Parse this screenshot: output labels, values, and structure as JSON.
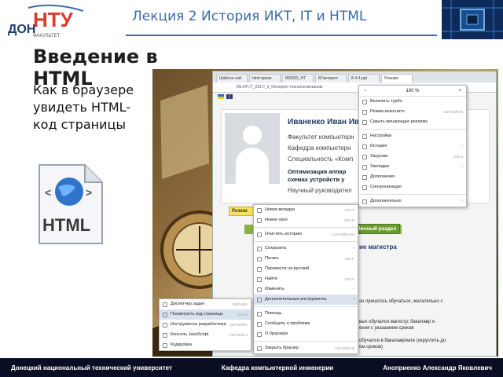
{
  "header": {
    "title": "Лекция 2 История ИКТ, IT и HTML",
    "logo_text_top": "ДОН",
    "logo_text_main": "НТУ",
    "logo_sub": "ФАКУЛЬТЕТ",
    "accent": "#3d6aa5"
  },
  "left": {
    "heading": "Введение в HTML",
    "body": "Как в браузере увидеть HTML-код страницы",
    "icon_label": "HTML"
  },
  "browser": {
    "tabs": [
      "Шаблон сай",
      "html-прези",
      "802050_HT",
      "БГинтерне",
      "8-4-4.ppt",
      "Резюме"
    ],
    "active_tab": 5,
    "address": "file:///F:/7_2017/_3_Интернет-технологии/заним",
    "page": {
      "name": "Иваненко Иван Ив",
      "lines": [
        "Факультет компьютерн",
        "Кафедра компьютерн",
        "Специальность «Комп"
      ],
      "bold_line_1": "Оптимизация аппар",
      "bold_line_2": "схемах устройств у",
      "advisor": "Научный руководител",
      "yellow_button": "Резюм",
      "green_button": "Личный раздел",
      "section_title": "ие магистра",
      "lower_lines": [
        "ах пришлось обучаться, желательно с",
        "вых обучался магистр; бакалавр и",
        "ения с указанием сроков",
        "обучался в бакалавриате (округлить до",
        "ом сроков)"
      ]
    }
  },
  "yandex_menu": {
    "zoom_minus": "−",
    "zoom_value": "100 %",
    "zoom_plus": "+",
    "items": [
      {
        "label": "Включить турбо",
        "shortcut": "",
        "arrow": ""
      },
      {
        "label": "Режим инкогнито",
        "shortcut": "Ctrl+Shift+N",
        "arrow": ""
      },
      {
        "label": "Скрыть мешающую рекламу",
        "shortcut": "",
        "arrow": ""
      },
      {
        "label": "Настройки",
        "shortcut": "",
        "arrow": ""
      },
      {
        "label": "История",
        "shortcut": "",
        "arrow": "›"
      },
      {
        "label": "Загрузки",
        "shortcut": "Ctrl+J",
        "arrow": ""
      },
      {
        "label": "Закладки",
        "shortcut": "",
        "arrow": "›"
      },
      {
        "label": "Дополнения",
        "shortcut": "",
        "arrow": ""
      },
      {
        "label": "Синхронизация",
        "shortcut": "",
        "arrow": ""
      },
      {
        "label": "Дополнительно",
        "shortcut": "",
        "arrow": "›"
      }
    ]
  },
  "context_menu": {
    "items": [
      {
        "label": "Новая вкладка",
        "shortcut": "Ctrl+T",
        "arrow": ""
      },
      {
        "label": "Новое окно",
        "shortcut": "Ctrl+N",
        "arrow": ""
      },
      {
        "label": "Очистить историю",
        "shortcut": "Ctrl+Shift+Del",
        "arrow": ""
      },
      {
        "label": "Сохранить",
        "shortcut": "",
        "arrow": "›"
      },
      {
        "label": "Печать",
        "shortcut": "Ctrl+P",
        "arrow": ""
      },
      {
        "label": "Перевести на русский",
        "shortcut": "",
        "arrow": ""
      },
      {
        "label": "Найти",
        "shortcut": "Ctrl+F",
        "arrow": ""
      },
      {
        "label": "Изменить",
        "shortcut": "",
        "arrow": "›"
      },
      {
        "label": "Дополнительные инструменты",
        "shortcut": "",
        "arrow": "›"
      },
      {
        "label": "Помощь",
        "shortcut": "",
        "arrow": ""
      },
      {
        "label": "Сообщить о проблеме",
        "shortcut": "",
        "arrow": ""
      },
      {
        "label": "О браузере",
        "shortcut": "",
        "arrow": ""
      },
      {
        "label": "Закрыть браузер",
        "shortcut": "Ctrl+Shift+Q",
        "arrow": ""
      }
    ]
  },
  "sub_menu": {
    "items": [
      {
        "label": "Диспетчер задач",
        "shortcut": "Shift+Esc"
      },
      {
        "label": "Посмотреть код страницы",
        "shortcut": "Ctrl+U"
      },
      {
        "label": "Инструменты разработчика",
        "shortcut": "Ctrl+Shift+I"
      },
      {
        "label": "Консоль JavaScript",
        "shortcut": "Ctrl+Shift+J"
      },
      {
        "label": "Кодировка",
        "shortcut": ""
      }
    ]
  },
  "footer": {
    "university": "Донецкий национальный технический университет",
    "department": "Кафедра компьютерной инженерии",
    "author": "Аноприенко Александр Яковлевич",
    "bg": "#0a0e24"
  }
}
